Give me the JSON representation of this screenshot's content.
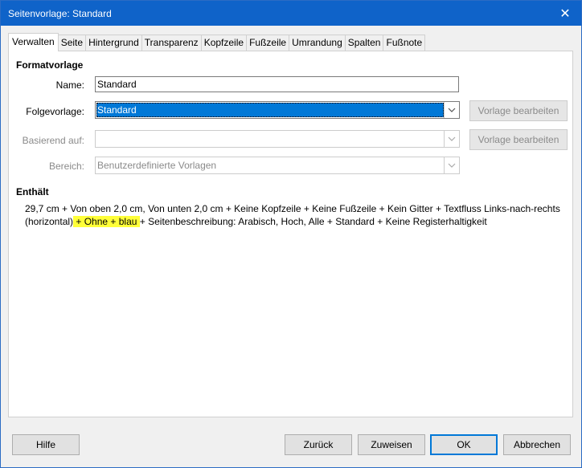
{
  "window": {
    "title": "Seitenvorlage: Standard",
    "close_symbol": "✕"
  },
  "tabs": [
    {
      "label": "Verwalten",
      "active": true
    },
    {
      "label": "Seite"
    },
    {
      "label": "Hintergrund"
    },
    {
      "label": "Transparenz"
    },
    {
      "label": "Kopfzeile"
    },
    {
      "label": "Fußzeile"
    },
    {
      "label": "Umrandung"
    },
    {
      "label": "Spalten"
    },
    {
      "label": "Fußnote"
    }
  ],
  "style": {
    "heading": "Formatvorlage",
    "name_label": "Name:",
    "name_value": "Standard",
    "next_label": "Folgevorlage:",
    "next_value": "Standard",
    "edit_style_1": "Vorlage bearbeiten",
    "based_label": "Basierend auf:",
    "based_value": "",
    "edit_style_2": "Vorlage bearbeiten",
    "category_label": "Bereich:",
    "category_value": "Benutzerdefinierte Vorlagen"
  },
  "contains": {
    "heading": "Enthält",
    "text_line1": "29,7 cm + Von oben 2,0 cm, Von unten 2,0 cm + Keine Kopfzeile + Keine Fußzeile + Kein Gitter + Textfluss Links-nach-rechts",
    "text_line2_pre": "(horizontal)",
    "text_line2_highlight": " + Ohne + blau ",
    "text_line2_post": "+ Seitenbeschreibung: Arabisch, Hoch, Alle + Standard + Keine Registerhaltigkeit"
  },
  "buttons": {
    "help": "Hilfe",
    "reset": "Zurück",
    "apply": "Zuweisen",
    "ok": "OK",
    "cancel": "Abbrechen"
  },
  "colors": {
    "titlebar": "#0f63c9",
    "selection": "#0078d7",
    "highlight": "#ffff38"
  }
}
